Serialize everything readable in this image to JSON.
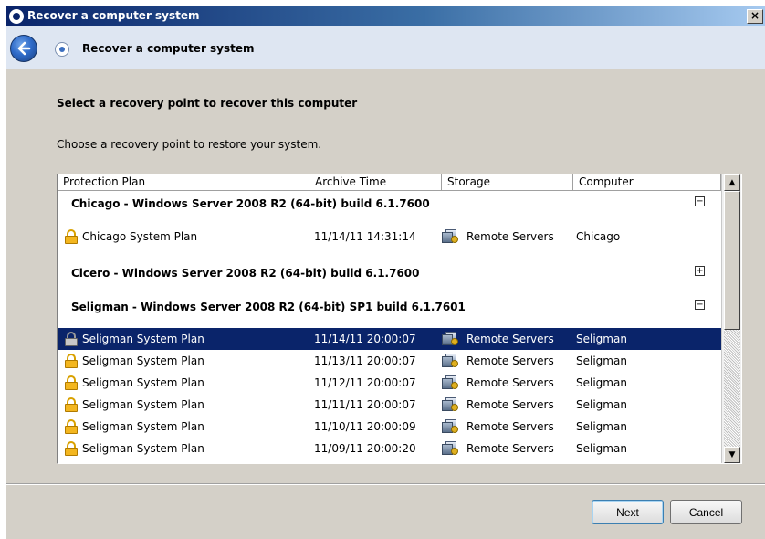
{
  "window": {
    "title": "Recover a computer system"
  },
  "header": {
    "title": "Recover a computer system"
  },
  "main": {
    "heading": "Select a recovery point to recover this computer",
    "subtext": "Choose a recovery point to restore your system."
  },
  "table": {
    "columns": [
      "Protection Plan",
      "Archive Time",
      "Storage",
      "Computer"
    ],
    "groups": [
      {
        "label": "Chicago - Windows Server 2008 R2 (64-bit) build 6.1.7600",
        "toggle": "−",
        "rows": [
          {
            "plan": "Chicago System Plan",
            "time": "11/14/11 14:31:14",
            "storage": "Remote Servers",
            "computer": "Chicago"
          }
        ]
      },
      {
        "label": "Cicero - Windows Server 2008 R2 (64-bit) build 6.1.7600",
        "toggle": "+",
        "rows": []
      },
      {
        "label": "Seligman - Windows Server 2008 R2 (64-bit) SP1 build 6.1.7601",
        "toggle": "−",
        "rows": [
          {
            "plan": "Seligman System Plan",
            "time": "11/14/11 20:00:07",
            "storage": "Remote Servers",
            "computer": "Seligman",
            "selected": true
          },
          {
            "plan": "Seligman System Plan",
            "time": "11/13/11 20:00:07",
            "storage": "Remote Servers",
            "computer": "Seligman"
          },
          {
            "plan": "Seligman System Plan",
            "time": "11/12/11 20:00:07",
            "storage": "Remote Servers",
            "computer": "Seligman"
          },
          {
            "plan": "Seligman System Plan",
            "time": "11/11/11 20:00:07",
            "storage": "Remote Servers",
            "computer": "Seligman"
          },
          {
            "plan": "Seligman System Plan",
            "time": "11/10/11 20:00:09",
            "storage": "Remote Servers",
            "computer": "Seligman"
          },
          {
            "plan": "Seligman System Plan",
            "time": "11/09/11 20:00:20",
            "storage": "Remote Servers",
            "computer": "Seligman"
          }
        ]
      }
    ]
  },
  "buttons": {
    "next": "Next",
    "cancel": "Cancel"
  },
  "colors": {
    "selection": "#0a246a",
    "title_bar": "#0a246a",
    "header_band": "#dee6f2",
    "dialog_bg": "#d4d0c8"
  },
  "icons": {
    "title": "recovery-icon",
    "back": "back-arrow-icon",
    "row_plan": "lock-icon",
    "row_storage": "remote-server-icon"
  }
}
